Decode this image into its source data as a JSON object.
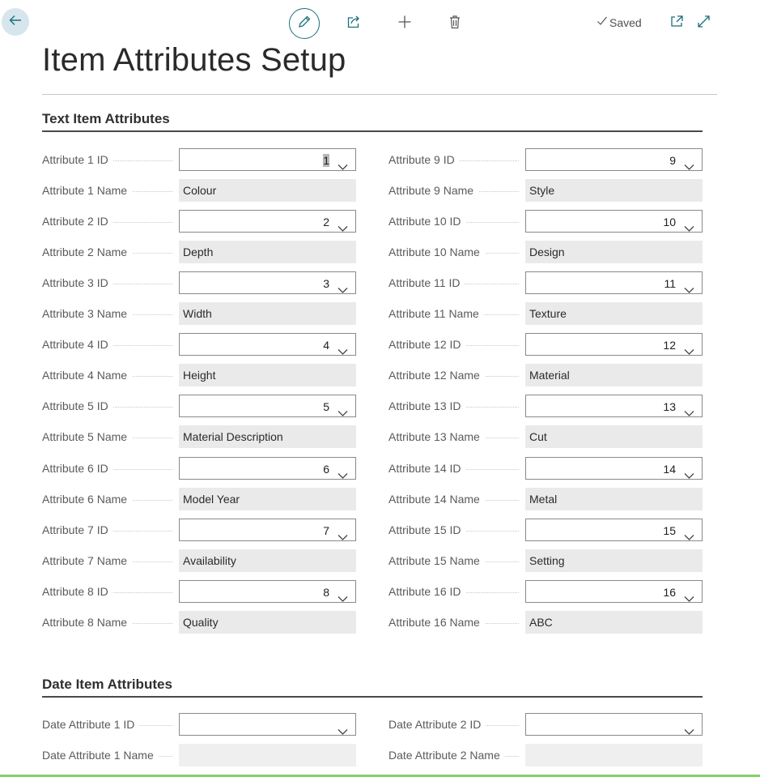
{
  "toolbar": {
    "back_icon": "arrow-left-icon",
    "edit_icon": "pencil-icon",
    "share_icon": "share-icon",
    "add_icon": "plus-icon",
    "delete_icon": "trash-icon",
    "saved_label": "Saved",
    "open_new_icon": "open-in-new-window-icon",
    "expand_icon": "expand-icon",
    "accent": "#1a6f7d"
  },
  "page": {
    "title": "Item Attributes Setup"
  },
  "text_section": {
    "heading": "Text Item Attributes",
    "left": [
      {
        "label": "Attribute 1 ID",
        "value": "1"
      },
      {
        "label": "Attribute 1 Name",
        "value": "Colour"
      },
      {
        "label": "Attribute 2 ID",
        "value": "2"
      },
      {
        "label": "Attribute 2 Name",
        "value": "Depth"
      },
      {
        "label": "Attribute 3 ID",
        "value": "3"
      },
      {
        "label": "Attribute 3 Name",
        "value": "Width"
      },
      {
        "label": "Attribute 4 ID",
        "value": "4"
      },
      {
        "label": "Attribute 4 Name",
        "value": "Height"
      },
      {
        "label": "Attribute 5 ID",
        "value": "5"
      },
      {
        "label": "Attribute 5 Name",
        "value": "Material Description"
      },
      {
        "label": "Attribute 6 ID",
        "value": "6"
      },
      {
        "label": "Attribute 6 Name",
        "value": "Model Year"
      },
      {
        "label": "Attribute 7 ID",
        "value": "7"
      },
      {
        "label": "Attribute 7 Name",
        "value": "Availability"
      },
      {
        "label": "Attribute 8 ID",
        "value": "8"
      },
      {
        "label": "Attribute 8 Name",
        "value": "Quality"
      }
    ],
    "right": [
      {
        "label": "Attribute 9 ID",
        "value": "9"
      },
      {
        "label": "Attribute 9 Name",
        "value": "Style"
      },
      {
        "label": "Attribute 10 ID",
        "value": "10"
      },
      {
        "label": "Attribute 10 Name",
        "value": "Design"
      },
      {
        "label": "Attribute 11 ID",
        "value": "11"
      },
      {
        "label": "Attribute 11 Name",
        "value": "Texture"
      },
      {
        "label": "Attribute 12 ID",
        "value": "12"
      },
      {
        "label": "Attribute 12 Name",
        "value": "Material"
      },
      {
        "label": "Attribute 13 ID",
        "value": "13"
      },
      {
        "label": "Attribute 13 Name",
        "value": "Cut"
      },
      {
        "label": "Attribute 14 ID",
        "value": "14"
      },
      {
        "label": "Attribute 14 Name",
        "value": "Metal"
      },
      {
        "label": "Attribute 15 ID",
        "value": "15"
      },
      {
        "label": "Attribute 15 Name",
        "value": "Setting"
      },
      {
        "label": "Attribute 16 ID",
        "value": "16"
      },
      {
        "label": "Attribute 16 Name",
        "value": "ABC"
      }
    ]
  },
  "date_section": {
    "heading": "Date Item Attributes",
    "left": [
      {
        "label": "Date Attribute 1 ID",
        "value": ""
      },
      {
        "label": "Date Attribute 1 Name",
        "value": ""
      }
    ],
    "right": [
      {
        "label": "Date Attribute 2 ID",
        "value": ""
      },
      {
        "label": "Date Attribute 2 Name",
        "value": ""
      }
    ]
  }
}
